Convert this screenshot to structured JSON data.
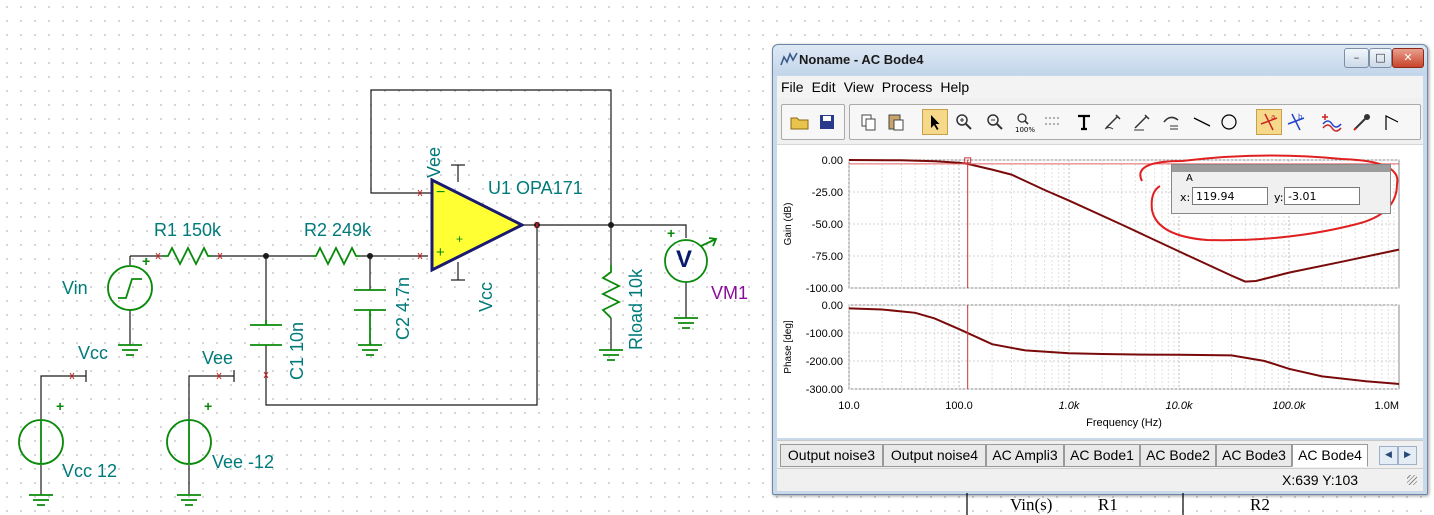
{
  "schematic": {
    "labels": {
      "r1": "R1 150k",
      "r2": "R2 249k",
      "u1": "U1 OPA171",
      "vin": "Vin",
      "vcc_net": "Vcc",
      "vee_net": "Vee",
      "c1": "C1 10n",
      "c2": "C2 4.7n",
      "vee_pin": "Vee",
      "vcc_pin": "Vcc",
      "rload": "Rload 10k",
      "vm1": "VM1",
      "vm_symbol": "V",
      "vcc_src": "Vcc 12",
      "vee_src": "Vee -12",
      "plus": "+",
      "minus": "−"
    },
    "colors": {
      "wire": "#1a1a1a",
      "component": "#0a8a0a",
      "label": "#007a7a",
      "opamp_fill": "#ffff33",
      "opamp_stroke": "#1a1a6e",
      "meter_label": "#8a0a9a"
    }
  },
  "window": {
    "title": "Noname - AC Bode4",
    "controls": {
      "minimize": "–",
      "maximize": "□",
      "close": "✕"
    },
    "menu": [
      "File",
      "Edit",
      "View",
      "Process",
      "Help"
    ],
    "toolbar_icons": [
      "open-folder-icon",
      "save-icon",
      "copy-icon",
      "paste-icon",
      "pointer-icon",
      "zoom-in-icon",
      "zoom-out-icon",
      "zoom-100-icon",
      "grid-icon",
      "text-icon",
      "pen-a-icon",
      "pen-b-icon",
      "pen-c-icon",
      "line-icon",
      "circle-icon",
      "cursor-a-icon",
      "cursor-b-icon",
      "curve-add-icon",
      "probe-icon",
      "marker-icon"
    ],
    "zoom_label": "100%"
  },
  "chart_data": [
    {
      "type": "line",
      "xscale": "log",
      "xlim": [
        10,
        1000000
      ],
      "ylabel": "Gain (dB)",
      "ylim": [
        -100,
        0
      ],
      "yticks": [
        "0.00",
        "-25.00",
        "-50.00",
        "-75.00",
        "-100.00"
      ],
      "grid": true,
      "series": [
        {
          "color": "#7a0a0a",
          "x": [
            10,
            30,
            60,
            100,
            120,
            200,
            300,
            600,
            1000,
            3000,
            10000,
            30000,
            40000,
            50000,
            100000,
            300000,
            1000000
          ],
          "y": [
            0,
            -0.2,
            -0.9,
            -2.2,
            -3.01,
            -7.5,
            -11.4,
            -23.4,
            -31.7,
            -50.4,
            -71.4,
            -90.3,
            -95.0,
            -94.5,
            -88.0,
            -79.5,
            -70.0
          ]
        }
      ]
    },
    {
      "type": "line",
      "xscale": "log",
      "xlim": [
        10,
        1000000
      ],
      "xlabel": "Frequency (Hz)",
      "xticks": [
        "10.0",
        "100.0",
        "1.0k",
        "10.0k",
        "100.0k",
        "1.0M"
      ],
      "ylabel": "Phase [deg]",
      "ylim": [
        -300,
        0
      ],
      "yticks": [
        "0.00",
        "-100.00",
        "-200.00",
        "-300.00"
      ],
      "grid": true,
      "series": [
        {
          "color": "#7a0a0a",
          "x": [
            10,
            20,
            40,
            60,
            100,
            200,
            400,
            1000,
            2000,
            5000,
            10000,
            30000,
            60000,
            100000,
            200000,
            500000,
            1000000
          ],
          "y": [
            -12,
            -16,
            -28,
            -48,
            -86,
            -140,
            -162,
            -172,
            -175,
            -177,
            -178,
            -180,
            -200,
            -228,
            -255,
            -272,
            -282
          ]
        }
      ]
    }
  ],
  "cursor": {
    "name": "A",
    "x_label": "x:",
    "x_value": "119.94",
    "y_label": "y:",
    "y_value": "-3.01"
  },
  "tabs": [
    "Output noise3",
    "Output noise4",
    "AC Ampli3",
    "AC Bode1",
    "AC Bode2",
    "AC Bode3",
    "AC Bode4"
  ],
  "tab_nav": {
    "left": "◀",
    "right": "▶"
  },
  "status": {
    "coords": "X:639  Y:103"
  },
  "table_header": {
    "vin": "Vin(s)",
    "r1": "R1",
    "r2": "R2"
  }
}
